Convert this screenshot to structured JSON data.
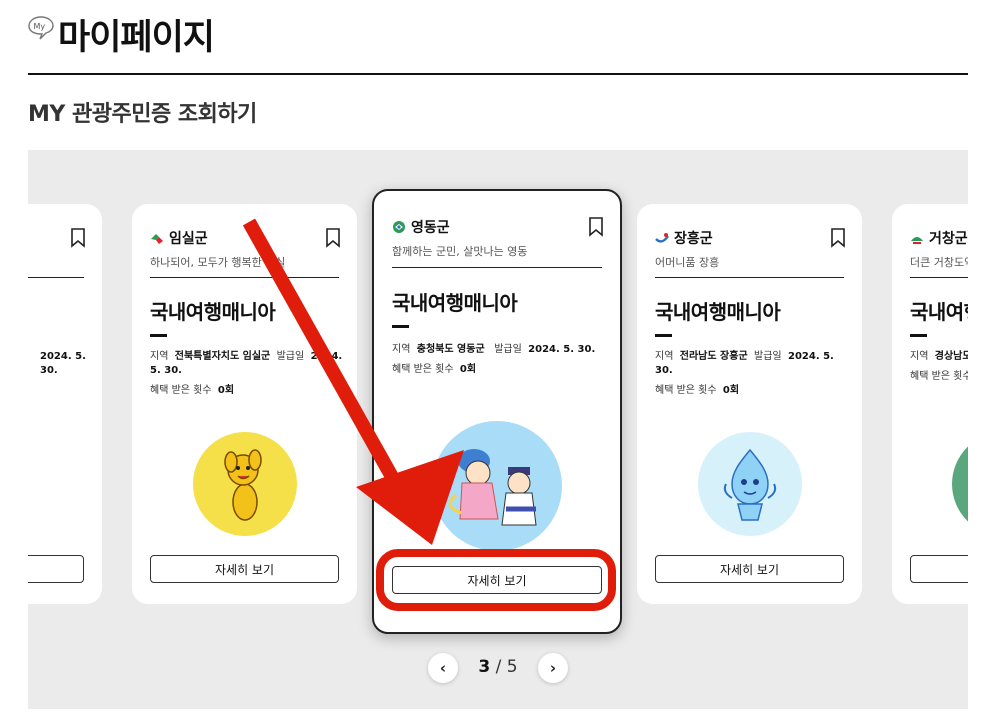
{
  "header": {
    "icon": "my-speech-bubble-icon",
    "icon_text": "My",
    "title": "마이페이지"
  },
  "section_title": "MY 관광주민증 조회하기",
  "cards": [
    {
      "region": "",
      "slogan": "",
      "badge": "",
      "region_label": "",
      "region_value": "",
      "issue_label": "",
      "issue_value": "2024. 5. 30.",
      "benefit_label": "",
      "benefit_value": "",
      "button": ""
    },
    {
      "region": "임실군",
      "slogan": "하나되어, 모두가 행복한 임실",
      "badge": "국내여행매니아",
      "region_label": "지역",
      "region_value": "전북특별자치도 임실군",
      "issue_label": "발급일",
      "issue_value": "2024. 5. 30.",
      "benefit_label": "혜택 받은 횟수",
      "benefit_value": "0회",
      "button": "자세히 보기",
      "mascot_color": "#f5e04a"
    },
    {
      "region": "영동군",
      "slogan": "함께하는 군민, 살맛나는 영동",
      "badge": "국내여행매니아",
      "region_label": "지역",
      "region_value": "충청북도 영동군",
      "issue_label": "발급일",
      "issue_value": "2024. 5. 30.",
      "benefit_label": "혜택 받은 횟수",
      "benefit_value": "0회",
      "button": "자세히 보기",
      "mascot_color": "#a9dcf7"
    },
    {
      "region": "장흥군",
      "slogan": "어머니품 장흥",
      "badge": "국내여행매니아",
      "region_label": "지역",
      "region_value": "전라남도 장흥군",
      "issue_label": "발급일",
      "issue_value": "2024. 5. 30.",
      "benefit_label": "혜택 받은 횟수",
      "benefit_value": "0회",
      "button": "자세히 보기",
      "mascot_color": "#d7f1fb"
    },
    {
      "region": "거창군",
      "slogan": "더큰 거창도약",
      "badge": "국내여행",
      "region_label": "지역",
      "region_value": "경상남도 거창군",
      "issue_label": "",
      "issue_value": "",
      "benefit_label": "혜택 받은 횟수",
      "benefit_value": "",
      "button": "",
      "mascot_color": "#5aa77e"
    }
  ],
  "pager": {
    "current": "3",
    "separator": "/",
    "total": "5",
    "prev_icon": "chevron-left-icon",
    "next_icon": "chevron-right-icon"
  },
  "colors": {
    "annotation_red": "#e01d0b",
    "carousel_bg": "#ebebeb"
  }
}
